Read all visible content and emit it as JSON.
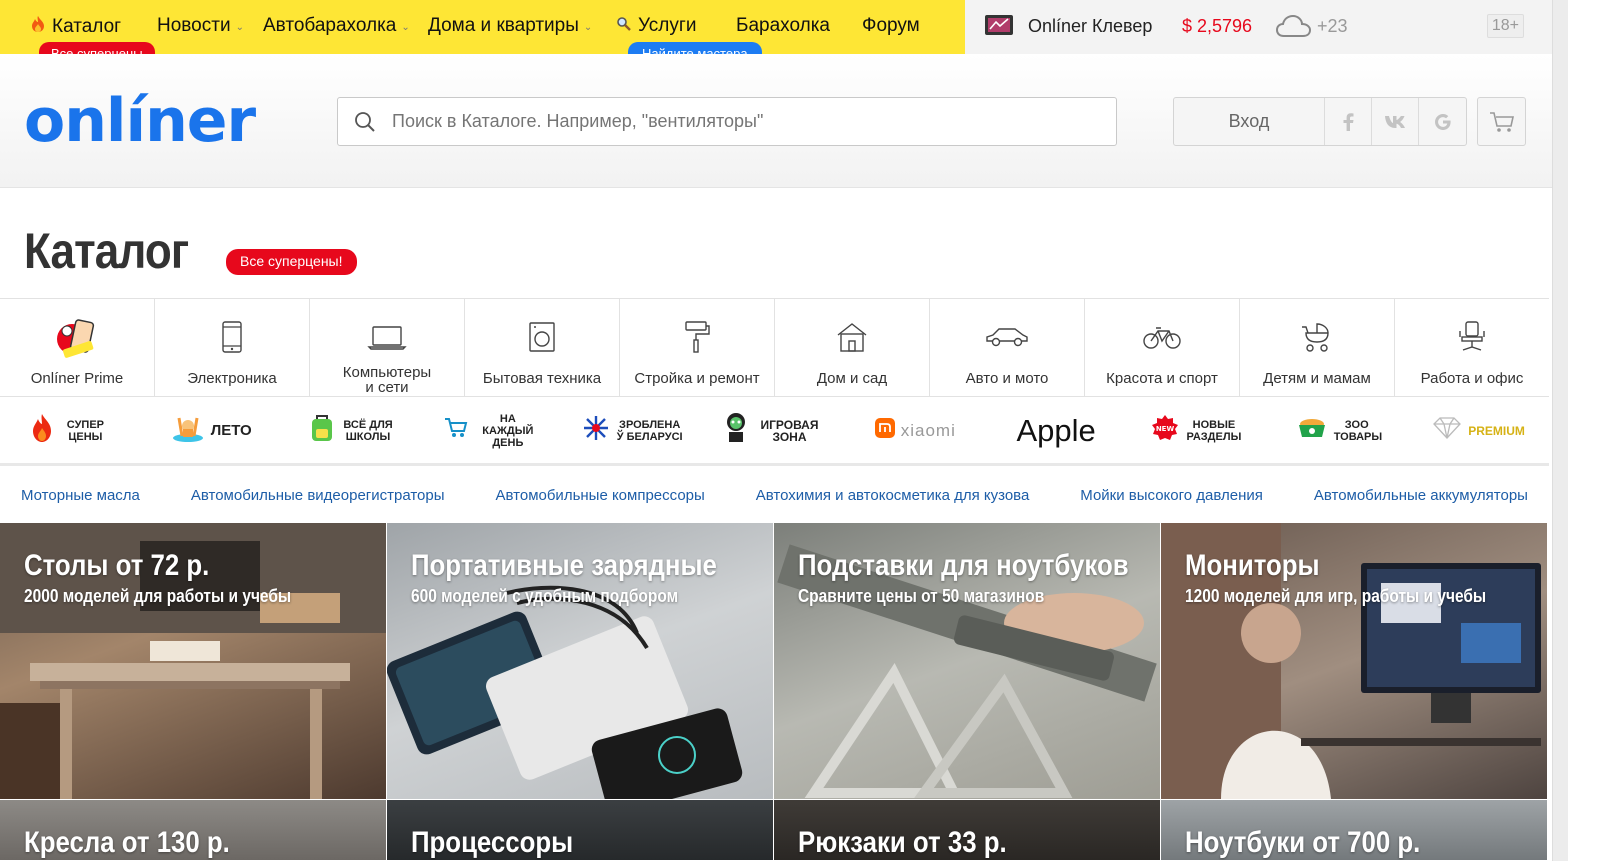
{
  "topnav": {
    "items": [
      {
        "label": "Каталог"
      },
      {
        "label": "Новости"
      },
      {
        "label": "Автобарахолка"
      },
      {
        "label": "Дома и квартиры"
      },
      {
        "label": "Услуги"
      },
      {
        "label": "Барахолка"
      },
      {
        "label": "Форум"
      }
    ],
    "catalog_badge": "Все суперцены",
    "services_badge": "Найдите мастера"
  },
  "topright": {
    "clever": "Onlíner Клевер",
    "currency": "$ 2,5796",
    "weather": "+23",
    "age": "18+"
  },
  "header": {
    "logo": "onlíner",
    "search_placeholder": "Поиск в Каталоге. Например, \"вентиляторы\"",
    "login": "Вход",
    "social": [
      "f",
      "vk",
      "G"
    ]
  },
  "catalog": {
    "title": "Каталог",
    "badge": "Все суперцены!"
  },
  "categories": [
    {
      "label": "Onlíner Prime",
      "icon": "prime-icon"
    },
    {
      "label": "Электроника",
      "icon": "smartphone-icon"
    },
    {
      "label": "Компьютеры и сети",
      "icon": "laptop-icon"
    },
    {
      "label": "Бытовая техника",
      "icon": "washer-icon"
    },
    {
      "label": "Стройка и ремонт",
      "icon": "paint-roller-icon"
    },
    {
      "label": "Дом и сад",
      "icon": "house-icon"
    },
    {
      "label": "Авто и мото",
      "icon": "car-icon"
    },
    {
      "label": "Красота и спорт",
      "icon": "bicycle-icon"
    },
    {
      "label": "Детям и мамам",
      "icon": "stroller-icon"
    },
    {
      "label": "Работа и офис",
      "icon": "office-chair-icon"
    }
  ],
  "promos": [
    {
      "label": "Супер цены",
      "icon": "flame-icon"
    },
    {
      "label": "Лето",
      "icon": "summer-icon"
    },
    {
      "label": "Всё для школы",
      "icon": "backpack-icon"
    },
    {
      "label": "На каждый день",
      "icon": "cart-icon"
    },
    {
      "label": "Зроблена ў Беларусі",
      "icon": "snowflake-icon"
    },
    {
      "label": "Игровая зона",
      "icon": "gamer-icon"
    },
    {
      "label": "xiaomi",
      "icon": "mi-logo-icon"
    },
    {
      "label": "Apple",
      "icon": "apple-logo"
    },
    {
      "label": "Новые разделы",
      "icon": "new-badge-icon"
    },
    {
      "label": "Зоо товары",
      "icon": "pet-bowl-icon"
    },
    {
      "label": "Premium",
      "icon": "diamond-icon"
    }
  ],
  "quicklinks": [
    "Моторные масла",
    "Автомобильные видеорегистраторы",
    "Автомобильные компрессоры",
    "Автохимия и автокосметика для кузова",
    "Мойки высокого давления",
    "Автомобильные аккумуляторы"
  ],
  "tiles": [
    {
      "title": "Столы от 72 р.",
      "subtitle": "2000 моделей для работы и учебы"
    },
    {
      "title": "Портативные зарядные",
      "subtitle": "600 моделей с удобным подбором"
    },
    {
      "title": "Подставки для ноутбуков",
      "subtitle": "Сравните цены от 50 магазинов"
    },
    {
      "title": "Мониторы",
      "subtitle": "1200 моделей для игр, работы и учебы"
    },
    {
      "title": "Кресла от 130 р.",
      "subtitle": ""
    },
    {
      "title": "Процессоры",
      "subtitle": ""
    },
    {
      "title": "Рюкзаки от 33 р.",
      "subtitle": ""
    },
    {
      "title": "Ноутбуки от 700 р.",
      "subtitle": ""
    }
  ],
  "colors": {
    "topnav_bg": "#fee635",
    "accent_red": "#e7081c",
    "brand_blue": "#1a74eb",
    "link_blue": "#1d5da7"
  }
}
